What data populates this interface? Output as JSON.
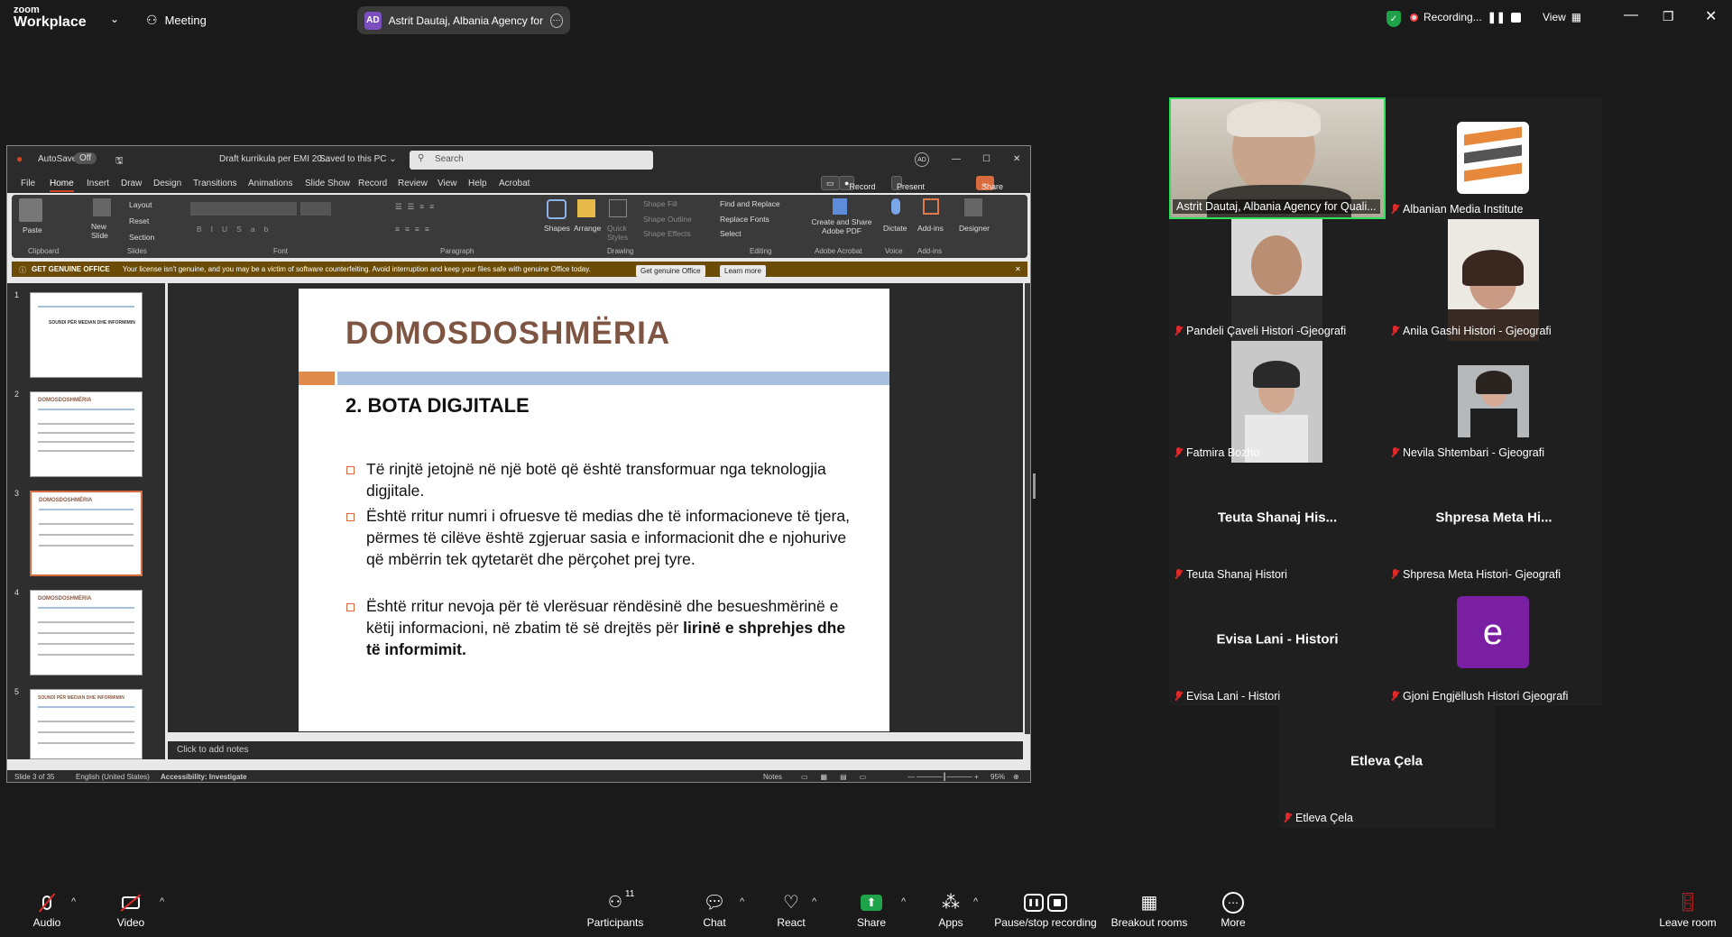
{
  "topbar": {
    "logo_line1": "zoom",
    "logo_line2": "Workplace",
    "meeting_label": "Meeting",
    "share_initials": "AD",
    "share_text": "Astrit Dautaj, Albania Agency for",
    "recording_label": "Recording...",
    "view_label": "View"
  },
  "ppt": {
    "autosave": "AutoSave",
    "autosave_state": "Off",
    "doc_title": "Draft kurrikula per EMI 20...",
    "saved_state": "Saved to this PC",
    "search_placeholder": "Search",
    "user_initials": "AD",
    "menu": [
      "File",
      "Home",
      "Insert",
      "Draw",
      "Design",
      "Transitions",
      "Animations",
      "Slide Show",
      "Record",
      "Review",
      "View",
      "Help",
      "Acrobat"
    ],
    "record_btn": "Record",
    "present_btn": "Present in Teams",
    "share_btn": "Share",
    "ribbon": {
      "paste": "Paste",
      "new_slide": "New Slide",
      "layout": "Layout",
      "reset": "Reset",
      "section": "Section",
      "shapes": "Shapes",
      "arrange": "Arrange",
      "quick_styles": "Quick Styles",
      "shape_fill": "Shape Fill",
      "shape_outline": "Shape Outline",
      "shape_effects": "Shape Effects",
      "find_replace": "Find and Replace",
      "replace_fonts": "Replace Fonts",
      "select": "Select",
      "create_pdf": "Create and Share Adobe PDF",
      "dictate": "Dictate",
      "addins": "Add-ins",
      "designer": "Designer",
      "groups": [
        "Clipboard",
        "Slides",
        "Font",
        "Paragraph",
        "Drawing",
        "Editing",
        "Adobe Acrobat",
        "Voice",
        "Add-ins"
      ]
    },
    "banner": {
      "title": "GET GENUINE OFFICE",
      "message": "Your license isn't genuine, and you may be a victim of software counterfeiting. Avoid interruption and keep your files safe with genuine Office today.",
      "btn1": "Get genuine Office",
      "btn2": "Learn more"
    },
    "thumbs": [
      {
        "num": "1",
        "title": "SOUNDI PËR MEDIAN DHE INFORMIMIN"
      },
      {
        "num": "2",
        "title": "DOMOSDOSHMËRIA"
      },
      {
        "num": "3",
        "title": "DOMOSDOSHMËRIA"
      },
      {
        "num": "4",
        "title": "DOMOSDOSHMËRIA"
      },
      {
        "num": "5",
        "title": "SOUNDI PËR MEDIAN DHE INFORMIMIN"
      }
    ],
    "slide": {
      "title": "DOMOSDOSHMËRIA",
      "subtitle": "2. BOTA DIGJITALE",
      "bullet1": "Të rinjtë jetojnë në një botë që është transformuar nga teknologjia digjitale.",
      "bullet2": "Është rritur numri i ofruesve të medias  dhe të informacioneve të tjera, përmes të cilëve është zgjeruar sasia e informacionit dhe e njohurive që mbërrin tek qytetarët dhe përçohet prej tyre.",
      "bullet3_a": " Është rritur nevoja për të  vlerësuar rëndësinë dhe besueshmërinë e këtij informacioni, në zbatim të së drejtës për ",
      "bullet3_b": "lirinë e shprehjes dhe të informimit."
    },
    "notes_placeholder": "Click to add notes",
    "status_slide": "Slide 3 of 35",
    "status_lang": "English (United States)",
    "status_access": "Accessibility: Investigate",
    "status_notes": "Notes",
    "status_zoom": "95%"
  },
  "participants": [
    {
      "name": "Astrit Dautaj, Albania Agency for Quali...",
      "muted": false
    },
    {
      "name": "Albanian Media Institute",
      "muted": true
    },
    {
      "name": "Pandeli Çaveli  Histori -Gjeografi",
      "muted": true
    },
    {
      "name": "Anila Gashi Histori - Gjeografi",
      "muted": true
    },
    {
      "name": "Fatmira  Bozho",
      "muted": true
    },
    {
      "name": "Nevila Shtembari - Gjeografi",
      "muted": true
    },
    {
      "name": "Teuta Shanaj Histori",
      "muted": true,
      "center": "Teuta Shanaj His..."
    },
    {
      "name": "Shpresa Meta Histori- Gjeografi",
      "muted": true,
      "center": "Shpresa Meta Hi..."
    },
    {
      "name": "Evisa Lani - Histori",
      "muted": true,
      "center": "Evisa Lani - Histori"
    },
    {
      "name": "Gjoni Engjëllush Histori Gjeografi",
      "muted": true,
      "avatar": "e"
    },
    {
      "name": "Etleva Çela",
      "muted": true,
      "center": "Etleva Çela"
    }
  ],
  "bottombar": {
    "audio": "Audio",
    "video": "Video",
    "participants": "Participants",
    "participants_count": "11",
    "chat": "Chat",
    "react": "React",
    "share": "Share",
    "apps": "Apps",
    "pause_stop": "Pause/stop recording",
    "breakout": "Breakout rooms",
    "more": "More",
    "leave": "Leave room"
  },
  "colors": {
    "accent_green": "#1fa34a",
    "mute_red": "#e02828",
    "avatar_purple": "#7b1fa2",
    "slide_title": "#7d5542"
  }
}
